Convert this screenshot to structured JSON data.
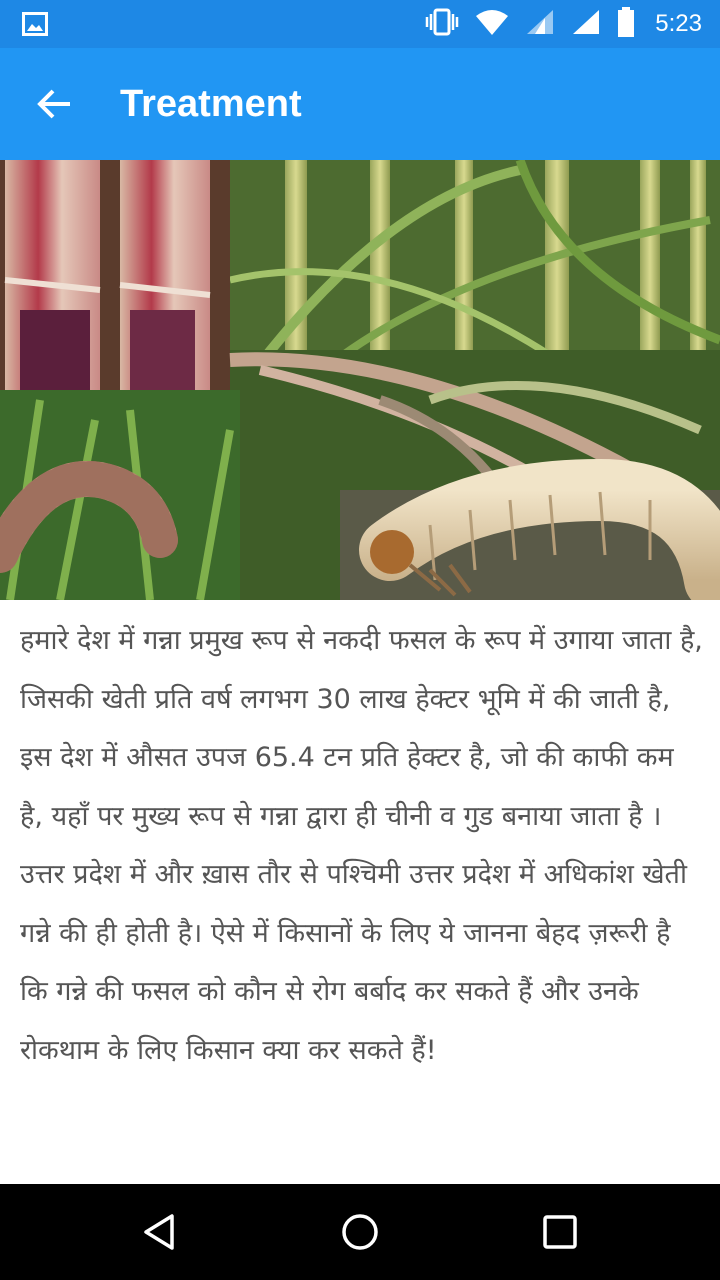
{
  "status_bar": {
    "time": "5:23",
    "icons": [
      "image-notification-icon",
      "vibrate-icon",
      "wifi-icon",
      "cell-signal-icon",
      "cell-signal-icon",
      "battery-icon"
    ]
  },
  "app_bar": {
    "title": "Treatment",
    "back_icon": "arrow-back-icon",
    "color": "#2196F3",
    "status_color": "#1E88E5"
  },
  "hero_image": {
    "description_icon": "sugarcane-pests-photo"
  },
  "article": {
    "body": "हमारे देश में गन्ना प्रमुख रूप से नकदी फसल के रूप में उगाया जाता है, जिसकी खेती प्रति वर्ष लगभग 30 लाख हेक्टर भूमि में की जाती है, इस देश में औसत उपज 65.4 टन प्रति हेक्टर है, जो की काफी कम है, यहाँ पर मुख्य रूप से गन्ना द्वारा ही चीनी व गुड बनाया जाता है ।उत्तर प्रदेश में और ख़ास तौर से पश्चिमी उत्तर प्रदेश में अधिकांश खेती गन्ने की ही होती है। ऐसे में किसानों के लिए ये जानना बेहद ज़रूरी है कि गन्ने की फसल को कौन से रोग बर्बाद कर सकते हैं और उनके रोकथाम के लिए किसान क्या कर सकते हैं!"
  },
  "nav_bar": {
    "icons": [
      "back-triangle-icon",
      "home-circle-icon",
      "recents-square-icon"
    ]
  }
}
